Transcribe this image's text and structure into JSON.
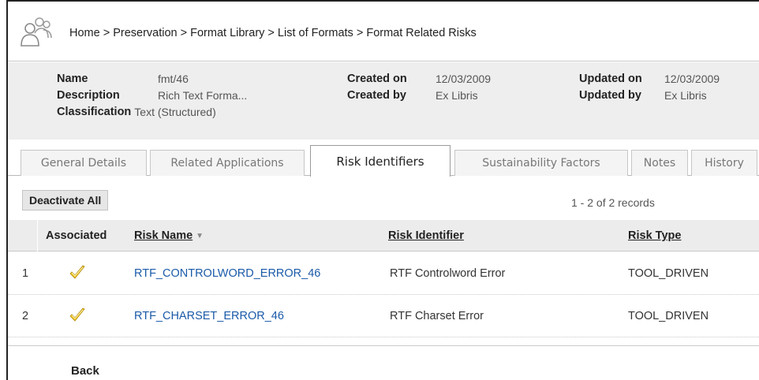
{
  "breadcrumb": "Home > Preservation > Format Library > List of Formats > Format Related Risks",
  "details": {
    "name_label": "Name",
    "name_value": "fmt/46",
    "description_label": "Description",
    "description_value": "Rich Text Forma...",
    "classification_label": "Classification",
    "classification_value": "Text (Structured)",
    "created_on_label": "Created on",
    "created_on_value": "12/03/2009",
    "created_by_label": "Created by",
    "created_by_value": "Ex Libris",
    "updated_on_label": "Updated on",
    "updated_on_value": "12/03/2009",
    "updated_by_label": "Updated by",
    "updated_by_value": "Ex Libris"
  },
  "tabs": [
    {
      "label": "General Details",
      "active": false
    },
    {
      "label": "Related Applications",
      "active": false
    },
    {
      "label": "Risk Identifiers",
      "active": true
    },
    {
      "label": "Sustainability Factors",
      "active": false
    },
    {
      "label": "Notes",
      "active": false
    },
    {
      "label": "History",
      "active": false
    }
  ],
  "toolbar": {
    "deactivate_label": "Deactivate All",
    "records_text": "1 - 2 of 2 records"
  },
  "table": {
    "headers": {
      "associated": "Associated",
      "risk_name": "Risk Name",
      "risk_identifier": "Risk Identifier",
      "risk_type": "Risk Type"
    },
    "rows": [
      {
        "num": "1",
        "associated": true,
        "risk_name": "RTF_CONTROLWORD_ERROR_46",
        "risk_identifier": "RTF Controlword Error",
        "risk_type": "TOOL_DRIVEN"
      },
      {
        "num": "2",
        "associated": true,
        "risk_name": "RTF_CHARSET_ERROR_46",
        "risk_identifier": "RTF Charset Error",
        "risk_type": "TOOL_DRIVEN"
      }
    ]
  },
  "footer": {
    "back_label": "Back"
  },
  "colors": {
    "link": "#1a5aa8",
    "check": "#f2c41a",
    "header_bg": "#ececec",
    "details_bg": "#eeeeee"
  },
  "icons": {
    "page_icon": "users-group-icon",
    "check_icon": "checkmark-icon",
    "sort_icon": "sort-down-icon"
  }
}
